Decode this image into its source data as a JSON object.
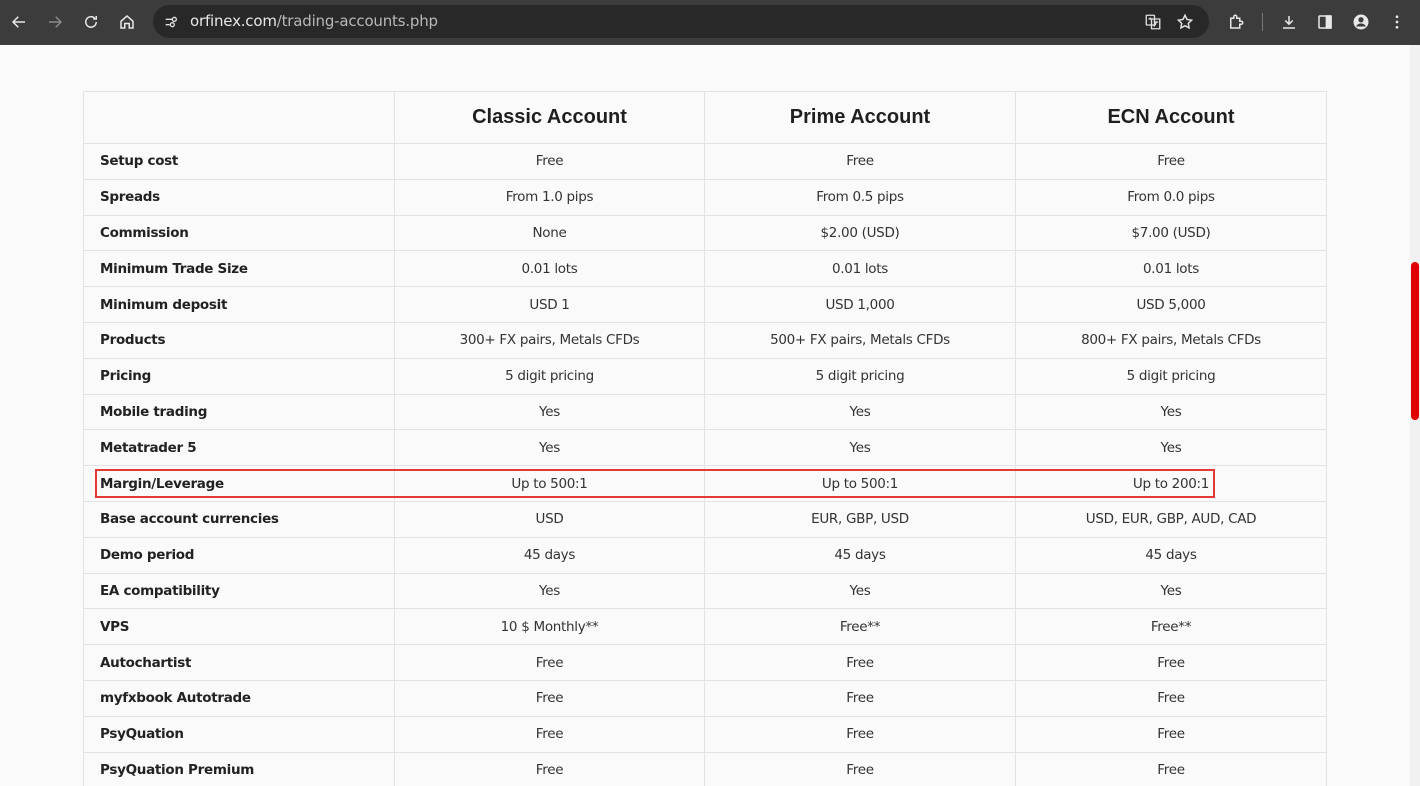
{
  "browser": {
    "url_host": "orfinex.com",
    "url_path": "/trading-accounts.php"
  },
  "table": {
    "headers": [
      "",
      "Classic Account",
      "Prime Account",
      "ECN Account"
    ],
    "rows": [
      {
        "label": "Setup cost",
        "values": [
          "Free",
          "Free",
          "Free"
        ]
      },
      {
        "label": "Spreads",
        "values": [
          "From 1.0 pips",
          "From 0.5 pips",
          "From 0.0 pips"
        ]
      },
      {
        "label": "Commission",
        "values": [
          "None",
          "$2.00 (USD)",
          "$7.00 (USD)"
        ]
      },
      {
        "label": "Minimum Trade Size",
        "values": [
          "0.01 lots",
          "0.01 lots",
          "0.01 lots"
        ]
      },
      {
        "label": "Minimum deposit",
        "values": [
          "USD 1",
          "USD 1,000",
          "USD 5,000"
        ]
      },
      {
        "label": "Products",
        "values": [
          "300+ FX pairs, Metals CFDs",
          "500+ FX pairs, Metals CFDs",
          "800+ FX pairs, Metals CFDs"
        ]
      },
      {
        "label": "Pricing",
        "values": [
          "5 digit pricing",
          "5 digit pricing",
          "5 digit pricing"
        ]
      },
      {
        "label": "Mobile trading",
        "values": [
          "Yes",
          "Yes",
          "Yes"
        ]
      },
      {
        "label": "Metatrader 5",
        "values": [
          "Yes",
          "Yes",
          "Yes"
        ]
      },
      {
        "label": "Margin/Leverage",
        "values": [
          "Up to 500:1",
          "Up to 500:1",
          "Up to 200:1"
        ]
      },
      {
        "label": "Base account currencies",
        "values": [
          "USD",
          "EUR, GBP, USD",
          "USD, EUR, GBP, AUD, CAD"
        ]
      },
      {
        "label": "Demo period",
        "values": [
          "45 days",
          "45 days",
          "45 days"
        ]
      },
      {
        "label": "EA compatibility",
        "values": [
          "Yes",
          "Yes",
          "Yes"
        ]
      },
      {
        "label": "VPS",
        "values": [
          "10 $ Monthly**",
          "Free**",
          "Free**"
        ]
      },
      {
        "label": "Autochartist",
        "values": [
          "Free",
          "Free",
          "Free"
        ]
      },
      {
        "label": "myfxbook Autotrade",
        "values": [
          "Free",
          "Free",
          "Free"
        ]
      },
      {
        "label": "PsyQuation",
        "values": [
          "Free",
          "Free",
          "Free"
        ]
      },
      {
        "label": "PsyQuation Premium",
        "values": [
          "Free",
          "Free",
          "Free"
        ]
      }
    ]
  },
  "colors": {
    "toolbar_bg": "#3c3c3c",
    "omnibox_bg": "#282828",
    "highlight": "#e53935",
    "scroll_thumb": "#e00000"
  }
}
